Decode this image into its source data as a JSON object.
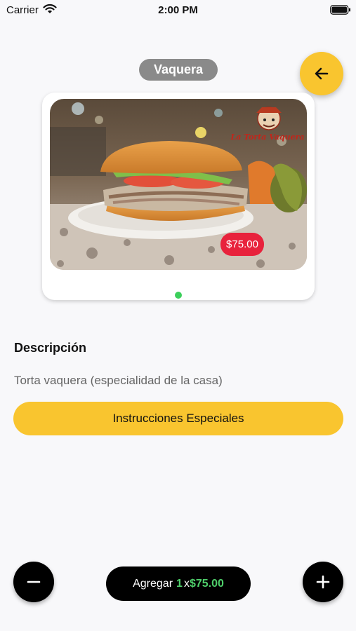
{
  "status_bar": {
    "carrier": "Carrier",
    "time": "2:00 PM"
  },
  "product": {
    "name": "Vaquera",
    "price": "$75.00",
    "photo_logo_text": "La Torta Vaquera"
  },
  "description": {
    "heading": "Descripción",
    "text": "Torta vaquera (especialidad de la casa)"
  },
  "special_instructions_label": "Instrucciones Especiales",
  "cart": {
    "add_label": "Agregar",
    "quantity": "1",
    "times": "x",
    "total": "$75.00"
  },
  "colors": {
    "accent_yellow": "#f9c52f",
    "price_red": "#e8223c",
    "quantity_green": "#4fd06b",
    "dot_green": "#3ccf5b"
  },
  "icons": {
    "back": "arrow-left-icon",
    "minus": "minus-icon",
    "plus": "plus-icon"
  }
}
